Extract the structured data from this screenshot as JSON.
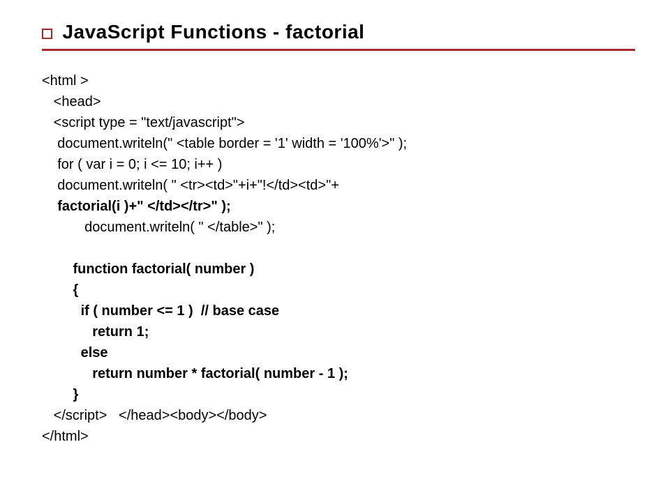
{
  "title": "JavaScript Functions - factorial",
  "code": {
    "l1": "<html >",
    "l2": "   <head>",
    "l3": "   <script type = \"text/javascript\">",
    "l4": "    document.writeln(\" <table border = '1' width = '100%'>\" );",
    "l5": "    for ( var i = 0; i <= 10; i++ )",
    "l6": "    document.writeln( \" <tr><td>\"+i+\"!</td><td>\"+",
    "l7": "    factorial(i )+\" </td></tr>\" );",
    "l8": "           document.writeln( \" </table>\" );",
    "l9": "",
    "l10": "        function factorial( number )",
    "l11": "        {",
    "l12": "          if ( number <= 1 )  // base case",
    "l13": "             return 1;",
    "l14": "          else",
    "l15": "             return number * factorial( number - 1 );",
    "l16": "        }",
    "end_script": "</script",
    "l17_rest": ">   </head><body></body>",
    "l18": "</html>"
  }
}
